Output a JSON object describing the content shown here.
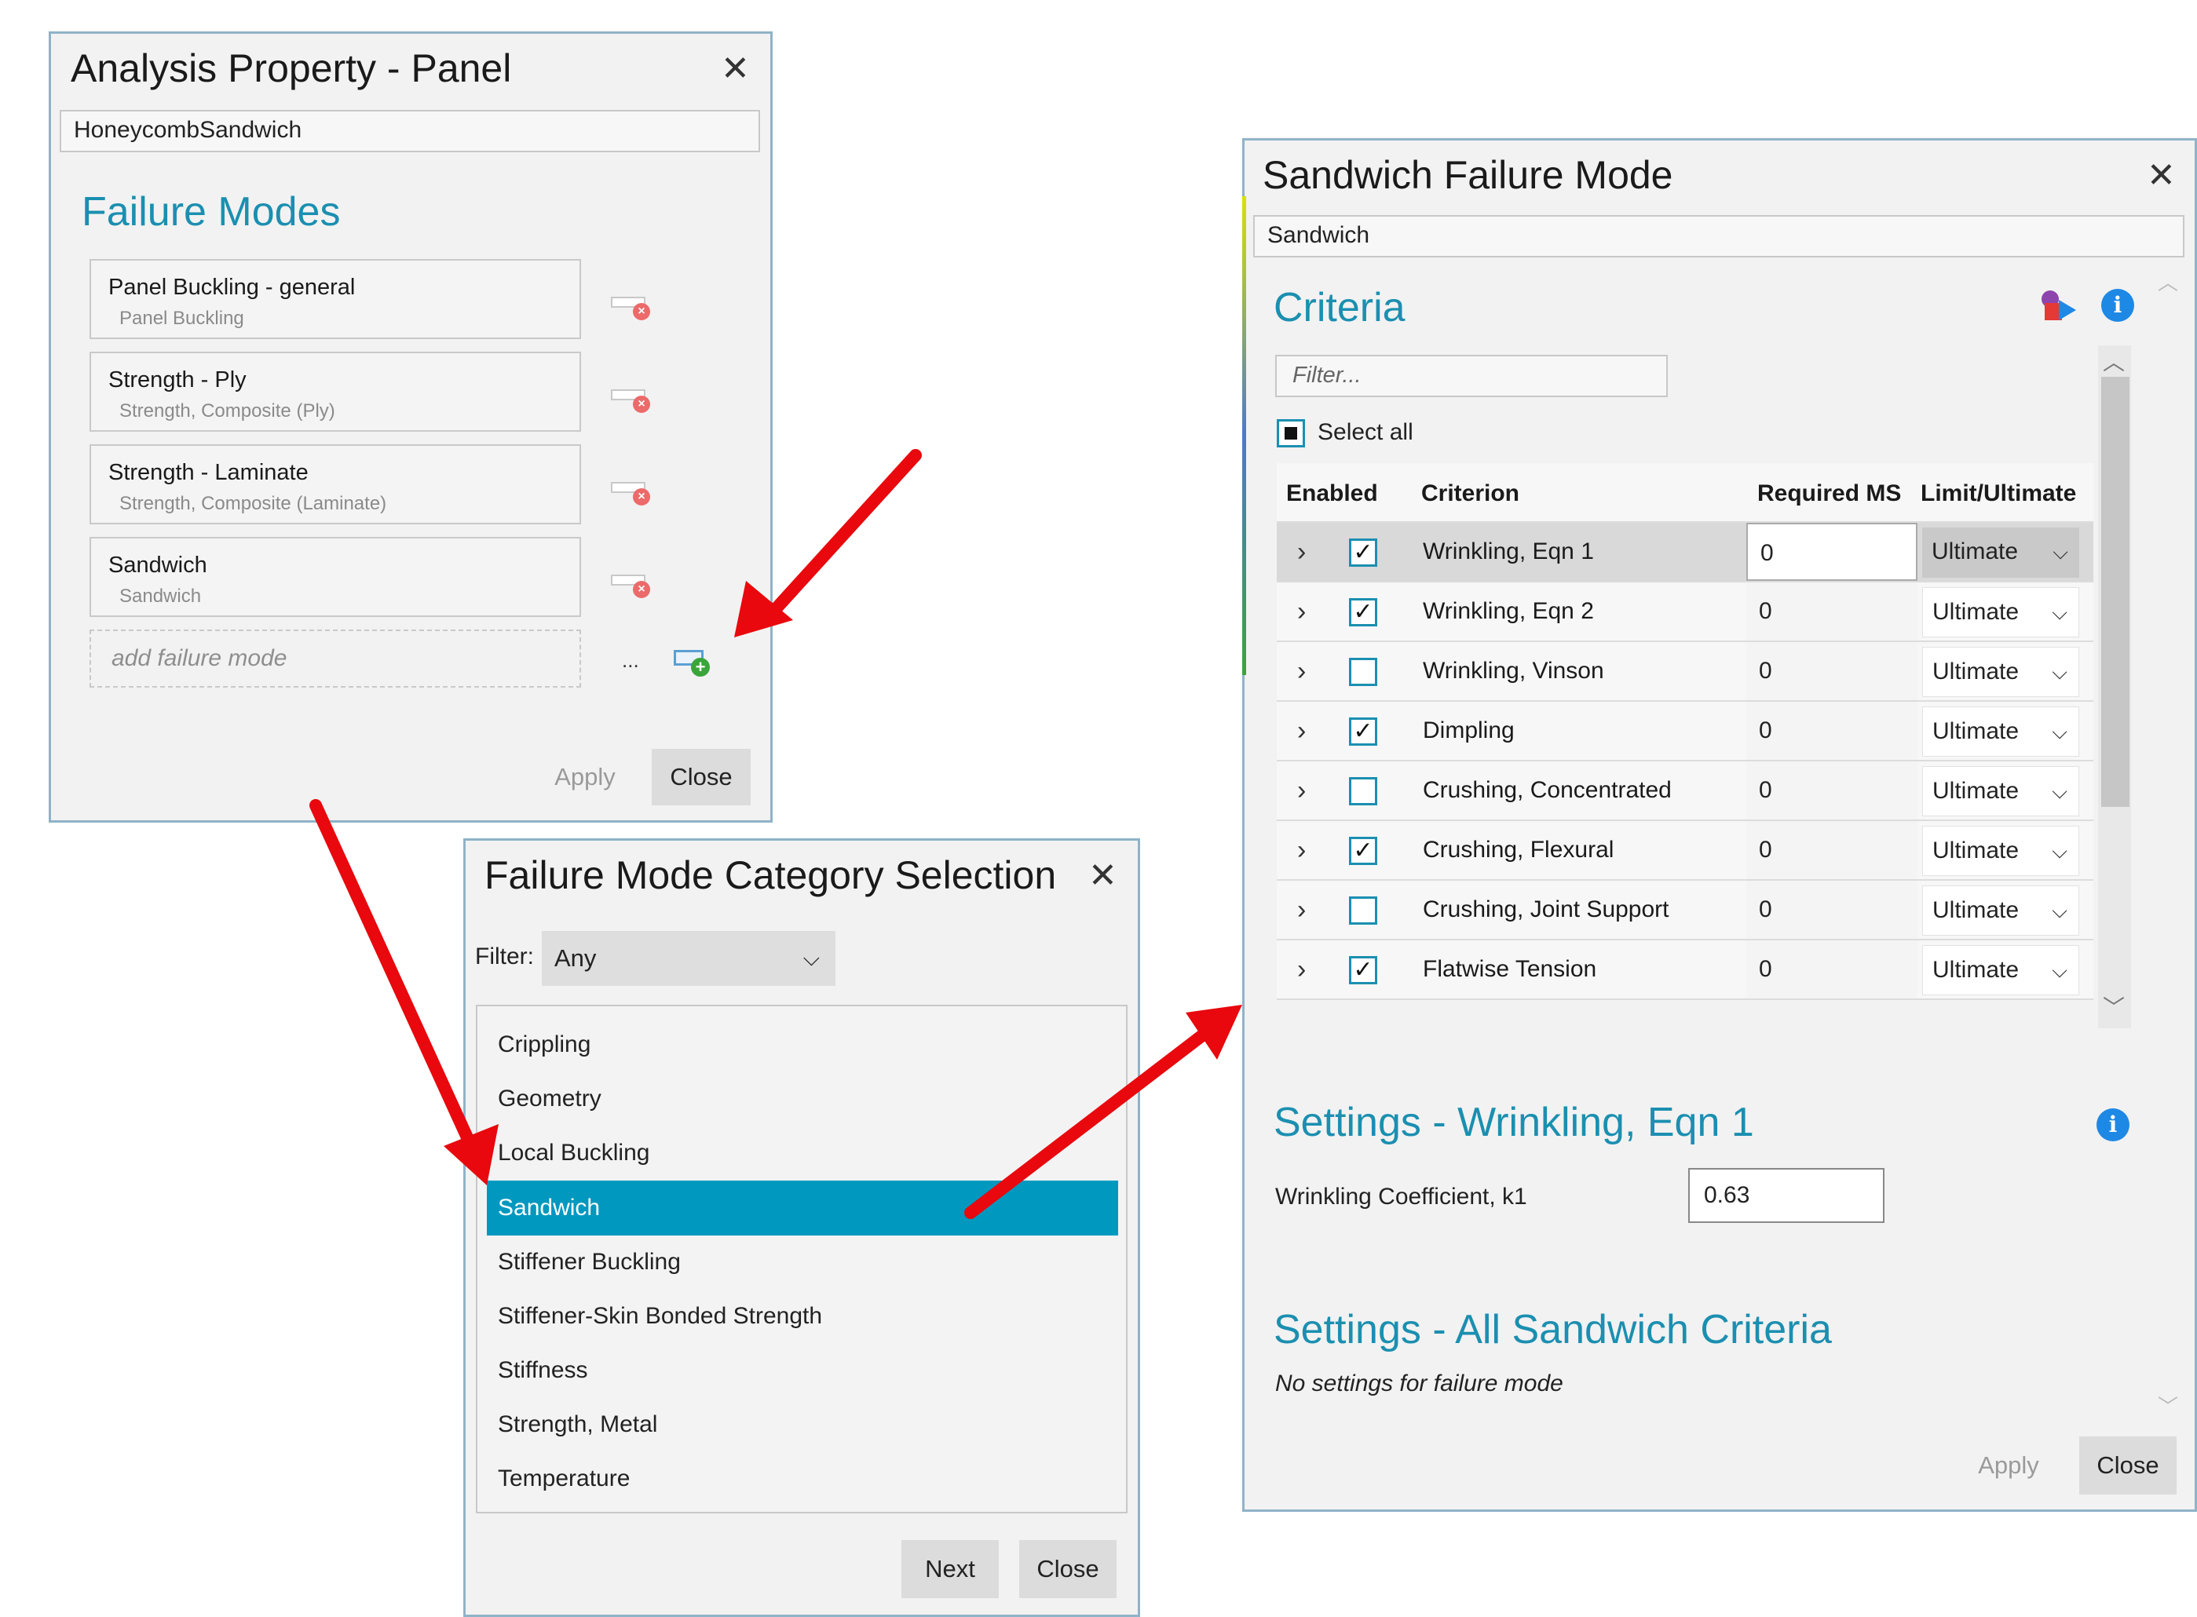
{
  "panel_dialog": {
    "title": "Analysis Property - Panel",
    "name_value": "HoneycombSandwich",
    "section_title": "Failure Modes",
    "failure_modes": [
      {
        "name": "Panel Buckling - general",
        "category": "Panel Buckling"
      },
      {
        "name": "Strength - Ply",
        "category": "Strength, Composite (Ply)"
      },
      {
        "name": "Strength - Laminate",
        "category": "Strength, Composite (Laminate)"
      },
      {
        "name": "Sandwich",
        "category": "Sandwich"
      }
    ],
    "add_placeholder": "add failure mode",
    "ellipsis": "...",
    "apply_label": "Apply",
    "close_label": "Close"
  },
  "category_dialog": {
    "title": "Failure Mode Category Selection",
    "filter_label": "Filter:",
    "filter_value": "Any",
    "categories": [
      "Crippling",
      "Geometry",
      "Local Buckling",
      "Sandwich",
      "Stiffener Buckling",
      "Stiffener-Skin Bonded Strength",
      "Stiffness",
      "Strength, Metal",
      "Temperature"
    ],
    "selected_category": "Sandwich",
    "next_label": "Next",
    "close_label": "Close"
  },
  "sandwich_dialog": {
    "title": "Sandwich Failure Mode",
    "name_value": "Sandwich",
    "criteria_title": "Criteria",
    "filter_placeholder": "Filter...",
    "select_all_label": "Select all",
    "columns": {
      "enabled": "Enabled",
      "criterion": "Criterion",
      "required_ms": "Required MS",
      "limit_ultimate": "Limit/Ultimate"
    },
    "rows": [
      {
        "criterion": "Wrinkling, Eqn 1",
        "enabled": true,
        "ms": "0",
        "lu": "Ultimate"
      },
      {
        "criterion": "Wrinkling, Eqn 2",
        "enabled": true,
        "ms": "0",
        "lu": "Ultimate"
      },
      {
        "criterion": "Wrinkling, Vinson",
        "enabled": false,
        "ms": "0",
        "lu": "Ultimate"
      },
      {
        "criterion": "Dimpling",
        "enabled": true,
        "ms": "0",
        "lu": "Ultimate"
      },
      {
        "criterion": "Crushing, Concentrated",
        "enabled": false,
        "ms": "0",
        "lu": "Ultimate"
      },
      {
        "criterion": "Crushing, Flexural",
        "enabled": true,
        "ms": "0",
        "lu": "Ultimate"
      },
      {
        "criterion": "Crushing, Joint Support",
        "enabled": false,
        "ms": "0",
        "lu": "Ultimate"
      },
      {
        "criterion": "Flatwise Tension",
        "enabled": true,
        "ms": "0",
        "lu": "Ultimate"
      }
    ],
    "settings_title": "Settings - Wrinkling, Eqn 1",
    "coef_label": "Wrinkling Coefficient, k1",
    "coef_value": "0.63",
    "settings_all_title": "Settings - All Sandwich Criteria",
    "no_settings_text": "No settings for failure mode",
    "apply_label": "Apply",
    "close_label": "Close"
  },
  "colors": {
    "accent": "#1b8fb0",
    "selection": "#0098bf",
    "arrow": "#e8080d",
    "delete": "#ec6a6a",
    "add": "#3aa53a",
    "info": "#1e88e5"
  }
}
